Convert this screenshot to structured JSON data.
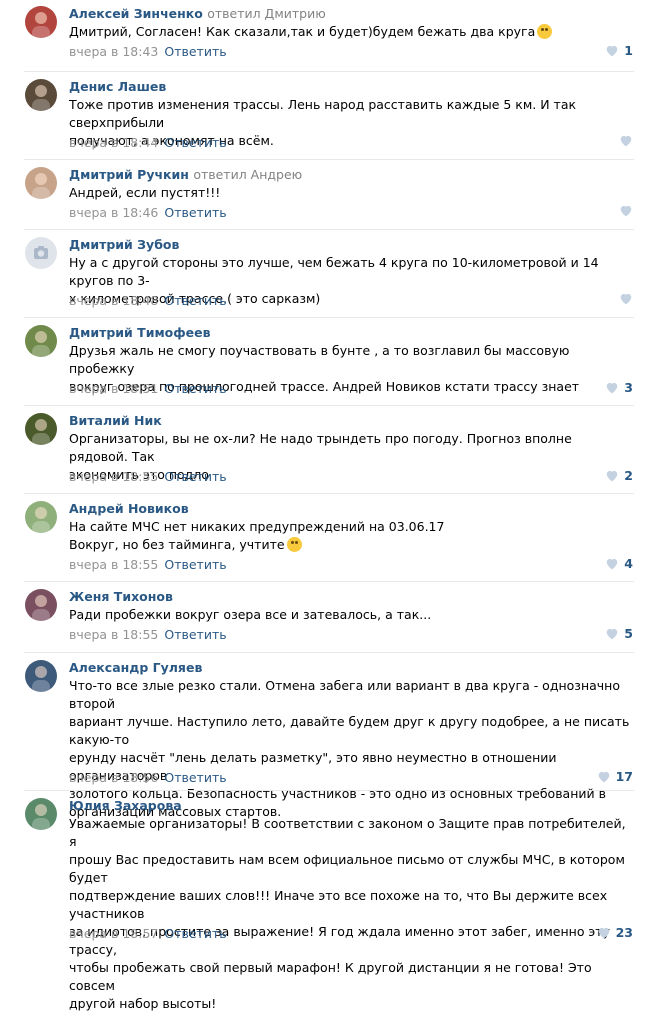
{
  "comments": [
    {
      "author": "Алексей Зинченко",
      "replied": "ответил Дмитрию",
      "text": "Дмитрий, Согласен! Как сказали,так и будет)будем бежать два круга",
      "emoji": "laughing-tears",
      "time": "вчера в 18:43",
      "reply": "Ответить",
      "likes": "1",
      "avatar_color": "#b3453f"
    },
    {
      "author": "Денис Лашев",
      "replied": "",
      "text": "Тоже против изменения трассы. Лень народ расставить каждые 5 км. И так сверхприбыли\nполучают, а экономят на всём.",
      "emoji": "",
      "time": "вчера в 18:44",
      "reply": "Ответить",
      "likes": "",
      "avatar_color": "#5a4a3a"
    },
    {
      "author": "Дмитрий Ручкин",
      "replied": "ответил Андрею",
      "text": "Андрей, если пустят!!!",
      "emoji": "",
      "time": "вчера в 18:46",
      "reply": "Ответить",
      "likes": "",
      "avatar_color": "#c7a38a"
    },
    {
      "author": "Дмитрий Зубов",
      "replied": "",
      "text": "Ну а с другой стороны это лучше, чем бежать 4 круга по 10-километровой и 14 кругов по 3-\nх километровой трассе.( это сарказм)",
      "emoji": "",
      "time": "вчера в 18:48",
      "reply": "Ответить",
      "likes": "",
      "avatar_color": "#dfe3ea"
    },
    {
      "author": "Дмитрий Тимофеев",
      "replied": "",
      "text": "Друзья жаль не смогу поучаствовать в бунте , а то возглавил бы массовую пробежку\nвокруг озера по прошлогодней трассе. Андрей Новиков кстати трассу знает",
      "emoji": "",
      "time": "вчера в 18:51",
      "reply": "Ответить",
      "likes": "3",
      "avatar_color": "#6f8a4a"
    },
    {
      "author": "Виталий Ник",
      "replied": "",
      "text": "Организаторы, вы не ох-ли? Не надо трындеть про погоду. Прогноз вполне рядовой. Так\nэкономить это подло",
      "emoji": "",
      "time": "вчера в 18:55",
      "reply": "Ответить",
      "likes": "2",
      "avatar_color": "#4a5a2a"
    },
    {
      "author": "Андрей Новиков",
      "replied": "",
      "text": "На сайте МЧС нет никаких предупреждений на 03.06.17\nВокруг, но без тайминга, учтите",
      "emoji": "wink",
      "time": "вчера в 18:55",
      "reply": "Ответить",
      "likes": "4",
      "avatar_color": "#8fb07a"
    },
    {
      "author": "Женя Тихонов",
      "replied": "",
      "text": "Ради пробежки вокруг озера все и затевалось, а так...",
      "emoji": "",
      "time": "вчера в 18:55",
      "reply": "Ответить",
      "likes": "5",
      "avatar_color": "#7a4f5f"
    },
    {
      "author": "Александр Гуляев",
      "replied": "",
      "text": "Что-то все злые резко стали. Отмена забега или вариант в два круга - однозначно второй\nвариант лучше. Наступило лето, давайте будем друг к другу подобрее, а не писать какую-то\nерунду насчёт \"лень делать разметку\", это явно неуместно в отношении организаторов\nзолотого кольца. Безопасность участников - это одно из основных требований в\nорганизации массовых стартов.",
      "emoji": "",
      "time": "вчера в 18:56",
      "reply": "Ответить",
      "likes": "17",
      "avatar_color": "#3e5a7a"
    },
    {
      "author": "Юлия Захарова",
      "replied": "",
      "text": "Уважаемые организаторы! В соответствии с законом о Защите прав потребителей, я\nпрошу Вас предоставить нам всем официальное письмо от службы МЧС, в котором будет\nподтверждение ваших слов!!! Иначе это все похоже на то, что Вы держите всех участников\nза идиотов, простите за выражение! Я год ждала именно этот забег, именно эту трассу,\nчтобы пробежать свой первый марафон! К другой дистанции я не готова! Это совсем\nдругой набор высоты!",
      "emoji": "",
      "time": "вчера в 18:57",
      "reply": "Ответить",
      "likes": "23",
      "avatar_color": "#5a8a6a"
    }
  ]
}
